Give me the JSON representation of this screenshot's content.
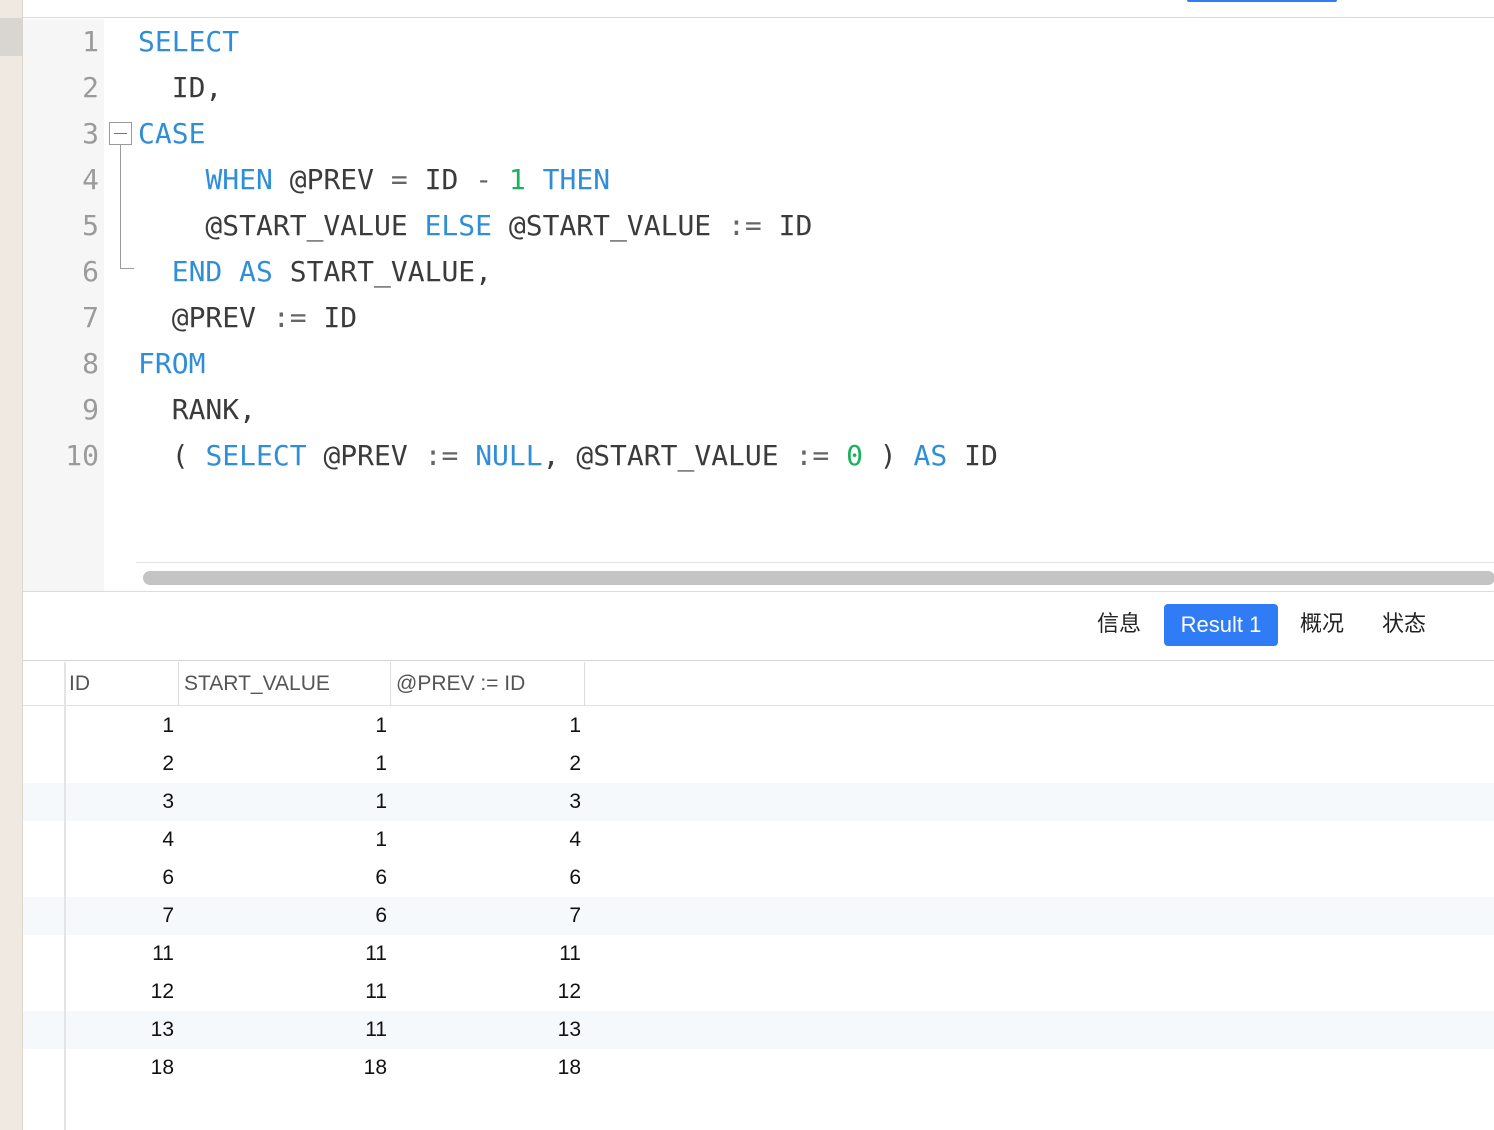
{
  "editor": {
    "line_numbers": [
      "1",
      "2",
      "3",
      "4",
      "5",
      "6",
      "7",
      "8",
      "9",
      "10"
    ],
    "lines": [
      [
        {
          "t": "SELECT",
          "c": "kw"
        }
      ],
      [
        {
          "t": "  ID,",
          "c": ""
        }
      ],
      [
        {
          "t": "CASE",
          "c": "kw"
        }
      ],
      [
        {
          "t": "    ",
          "c": ""
        },
        {
          "t": "WHEN",
          "c": "kw"
        },
        {
          "t": " @PREV ",
          "c": ""
        },
        {
          "t": "=",
          "c": "op"
        },
        {
          "t": " ID ",
          "c": ""
        },
        {
          "t": "-",
          "c": "op"
        },
        {
          "t": " ",
          "c": ""
        },
        {
          "t": "1",
          "c": "num"
        },
        {
          "t": " ",
          "c": ""
        },
        {
          "t": "THEN",
          "c": "kw"
        }
      ],
      [
        {
          "t": "    @START_VALUE ",
          "c": ""
        },
        {
          "t": "ELSE",
          "c": "kw"
        },
        {
          "t": " @START_VALUE ",
          "c": ""
        },
        {
          "t": ":=",
          "c": "op"
        },
        {
          "t": " ID",
          "c": ""
        }
      ],
      [
        {
          "t": "  ",
          "c": ""
        },
        {
          "t": "END",
          "c": "kw"
        },
        {
          "t": " ",
          "c": ""
        },
        {
          "t": "AS",
          "c": "kw"
        },
        {
          "t": " START_VALUE,",
          "c": ""
        }
      ],
      [
        {
          "t": "  @PREV ",
          "c": ""
        },
        {
          "t": ":=",
          "c": "op"
        },
        {
          "t": " ID",
          "c": ""
        }
      ],
      [
        {
          "t": "FROM",
          "c": "kw"
        }
      ],
      [
        {
          "t": "  RANK,",
          "c": ""
        }
      ],
      [
        {
          "t": "  ( ",
          "c": ""
        },
        {
          "t": "SELECT",
          "c": "kw"
        },
        {
          "t": " @PREV ",
          "c": ""
        },
        {
          "t": ":=",
          "c": "op"
        },
        {
          "t": " ",
          "c": ""
        },
        {
          "t": "NULL",
          "c": "kw"
        },
        {
          "t": ", @START_VALUE ",
          "c": ""
        },
        {
          "t": ":=",
          "c": "op"
        },
        {
          "t": " ",
          "c": ""
        },
        {
          "t": "0",
          "c": "num"
        },
        {
          "t": " ) ",
          "c": ""
        },
        {
          "t": "AS",
          "c": "kw"
        },
        {
          "t": " ID",
          "c": ""
        }
      ]
    ]
  },
  "tabs": {
    "info": "信息",
    "result1": "Result 1",
    "overview": "概况",
    "status": "状态",
    "active_color": "#2f7cf6"
  },
  "grid": {
    "columns": [
      "ID",
      "START_VALUE",
      "@PREV := ID"
    ],
    "rows": [
      [
        "1",
        "1",
        "1"
      ],
      [
        "2",
        "1",
        "2"
      ],
      [
        "3",
        "1",
        "3"
      ],
      [
        "4",
        "1",
        "4"
      ],
      [
        "6",
        "6",
        "6"
      ],
      [
        "7",
        "6",
        "7"
      ],
      [
        "11",
        "11",
        "11"
      ],
      [
        "12",
        "11",
        "12"
      ],
      [
        "13",
        "11",
        "13"
      ],
      [
        "18",
        "18",
        "18"
      ]
    ]
  }
}
